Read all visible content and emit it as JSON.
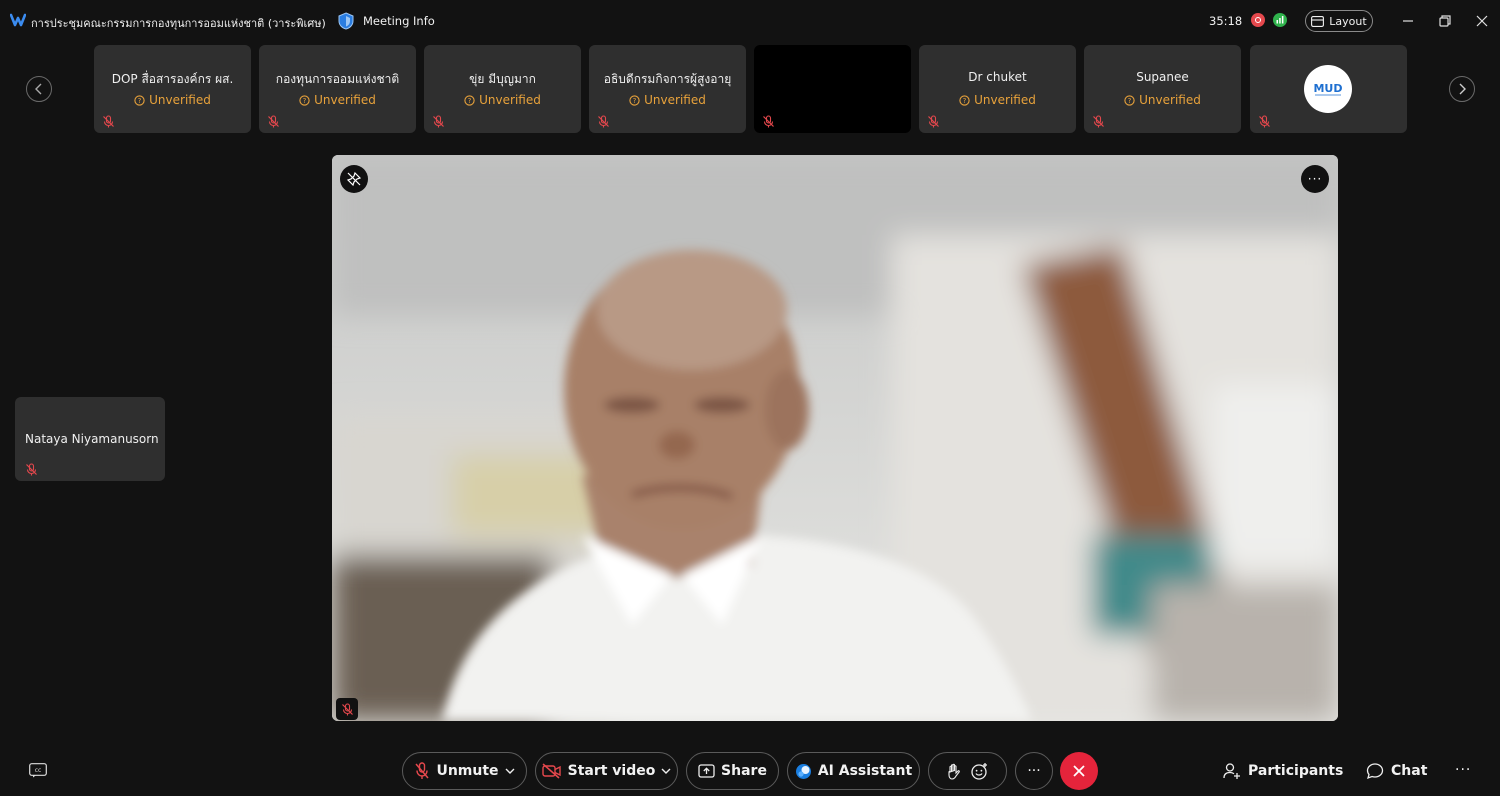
{
  "window": {
    "title": "การประชุมคณะกรรมการกองทุนการออมแห่งชาติ (วาระพิเศษ)",
    "meeting_info": "Meeting Info",
    "timer": "35:18",
    "layout_label": "Layout"
  },
  "participants_strip": [
    {
      "name": "DOP สื่อสารองค์กร ผส.",
      "status": "Unverified",
      "muted": true
    },
    {
      "name": "กองทุนการออมแห่งชาติ",
      "status": "Unverified",
      "muted": true
    },
    {
      "name": "ขุ่ย  มีบุญมาก",
      "status": "Unverified",
      "muted": true
    },
    {
      "name": "อธิบดีกรมกิจการผู้สูงอายุ",
      "status": "Unverified",
      "muted": true
    },
    {
      "name": "",
      "status": "",
      "muted": true,
      "video": "black"
    },
    {
      "name": "Dr chuket",
      "status": "Unverified",
      "muted": true
    },
    {
      "name": "Supanee",
      "status": "Unverified",
      "muted": true
    },
    {
      "name": "",
      "status": "",
      "muted": true,
      "avatar_logo": "MUD"
    }
  ],
  "side_tile": {
    "name": "Nataya Niyamanusorn",
    "muted": true
  },
  "controls": {
    "unmute": "Unmute",
    "start_video": "Start video",
    "share": "Share",
    "ai_assistant": "AI Assistant",
    "participants": "Participants",
    "chat": "Chat",
    "more": "···"
  },
  "colors": {
    "background": "#121212",
    "tile": "#2f2f2f",
    "unverified": "#e8a23b",
    "end_call": "#e5243b",
    "muted_icon": "#e5484d"
  }
}
